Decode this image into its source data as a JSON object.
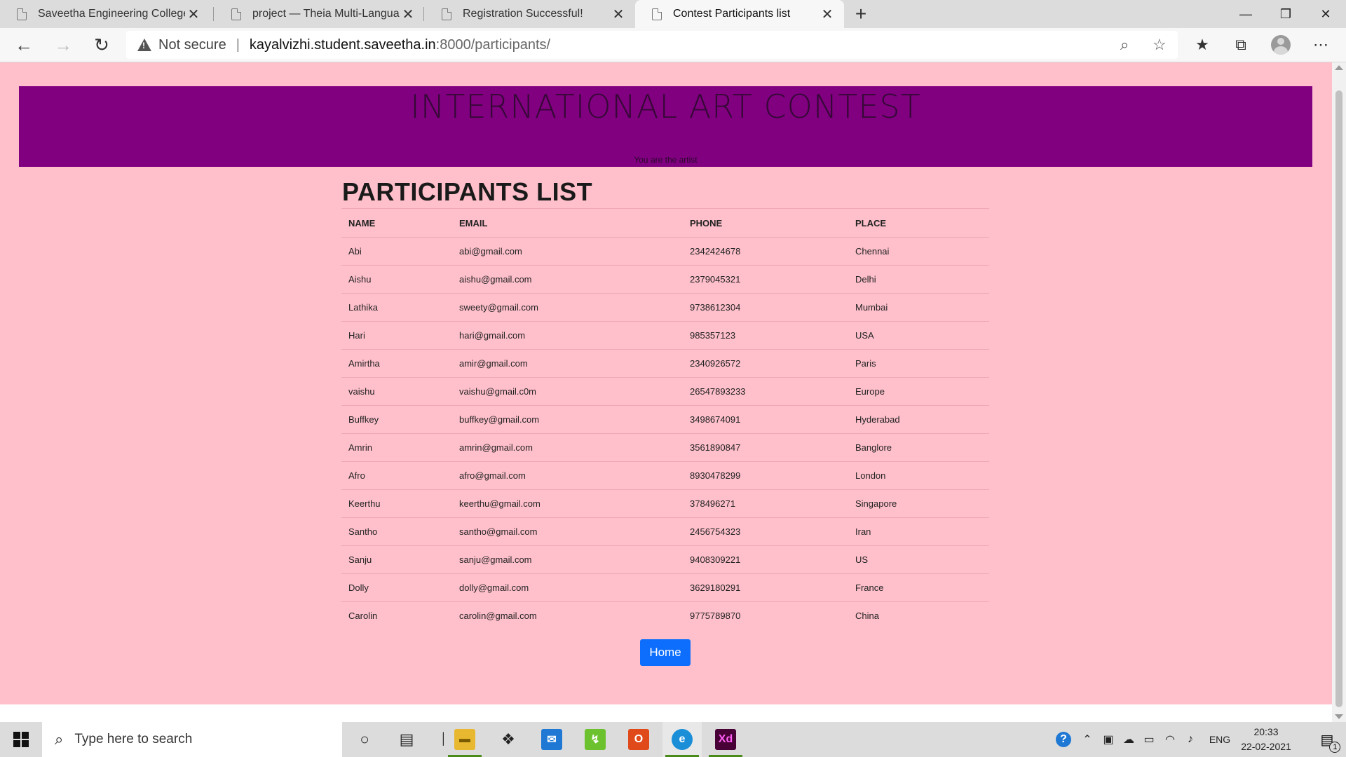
{
  "browser": {
    "tabs": [
      {
        "title": "Saveetha Engineering College",
        "active": false
      },
      {
        "title": "project — Theia Multi-Language",
        "active": false
      },
      {
        "title": "Registration Successful!",
        "active": false
      },
      {
        "title": "Contest Participants list",
        "active": true
      }
    ],
    "close_glyph": "✕",
    "new_tab_glyph": "+",
    "window_controls": {
      "minimize": "—",
      "maximize": "❐",
      "close": "✕"
    },
    "address": {
      "security_label": "Not secure",
      "separator": "|",
      "host": "kayalvizhi.student.saveetha.in",
      "path": ":8000/participants/"
    },
    "nav": {
      "back": "←",
      "forward": "→",
      "reload": "↻"
    },
    "toolbar_icons": {
      "zoom": "⌕",
      "add_favorite": "☆",
      "favorites": "★",
      "collections": "⧉",
      "more": "⋯"
    }
  },
  "page": {
    "banner": {
      "title": "INTERNATIONAL ART CONTEST",
      "subtitle": "You are the artist",
      "color": "#800080"
    },
    "background_color": "#ffc0cb",
    "list_title": "PARTICIPANTS LIST",
    "table": {
      "headers": [
        "NAME",
        "EMAIL",
        "PHONE",
        "PLACE"
      ],
      "rows": [
        [
          "Abi",
          "abi@gmail.com",
          "2342424678",
          "Chennai"
        ],
        [
          "Aishu",
          "aishu@gmail.com",
          "2379045321",
          "Delhi"
        ],
        [
          "Lathika",
          "sweety@gmail.com",
          "9738612304",
          "Mumbai"
        ],
        [
          "Hari",
          "hari@gmail.com",
          "985357123",
          "USA"
        ],
        [
          "Amirtha",
          "amir@gmail.com",
          "2340926572",
          "Paris"
        ],
        [
          "vaishu",
          "vaishu@gmail.c0m",
          "26547893233",
          "Europe"
        ],
        [
          "Buffkey",
          "buffkey@gmail.com",
          "3498674091",
          "Hyderabad"
        ],
        [
          "Amrin",
          "amrin@gmail.com",
          "3561890847",
          "Banglore"
        ],
        [
          "Afro",
          "afro@gmail.com",
          "8930478299",
          "London"
        ],
        [
          "Keerthu",
          "keerthu@gmail.com",
          "378496271",
          "Singapore"
        ],
        [
          "Santho",
          "santho@gmail.com",
          "2456754323",
          "Iran"
        ],
        [
          "Sanju",
          "sanju@gmail.com",
          "9408309221",
          "US"
        ],
        [
          "Dolly",
          "dolly@gmail.com",
          "3629180291",
          "France"
        ],
        [
          "Carolin",
          "carolin@gmail.com",
          "9775789870",
          "China"
        ]
      ]
    },
    "home_button": {
      "label": "Home",
      "color": "#0d6efd"
    }
  },
  "taskbar": {
    "search_placeholder": "Type here to search",
    "apps": [
      {
        "name": "cortana-icon",
        "glyph": "○"
      },
      {
        "name": "task-view-icon",
        "glyph": "▤"
      },
      {
        "name": "file-explorer-icon",
        "glyph": "📁"
      },
      {
        "name": "dropbox-icon",
        "glyph": "❖"
      },
      {
        "name": "mail-icon",
        "glyph": "✉"
      },
      {
        "name": "shared-app-icon",
        "glyph": "↯"
      },
      {
        "name": "office-icon",
        "glyph": "O"
      },
      {
        "name": "edge-icon",
        "glyph": "e"
      },
      {
        "name": "adobe-xd-icon",
        "glyph": "Xd"
      }
    ],
    "tray": {
      "language": "ENG",
      "time": "20:33",
      "date": "22-02-2021",
      "notification_count": "1"
    }
  }
}
